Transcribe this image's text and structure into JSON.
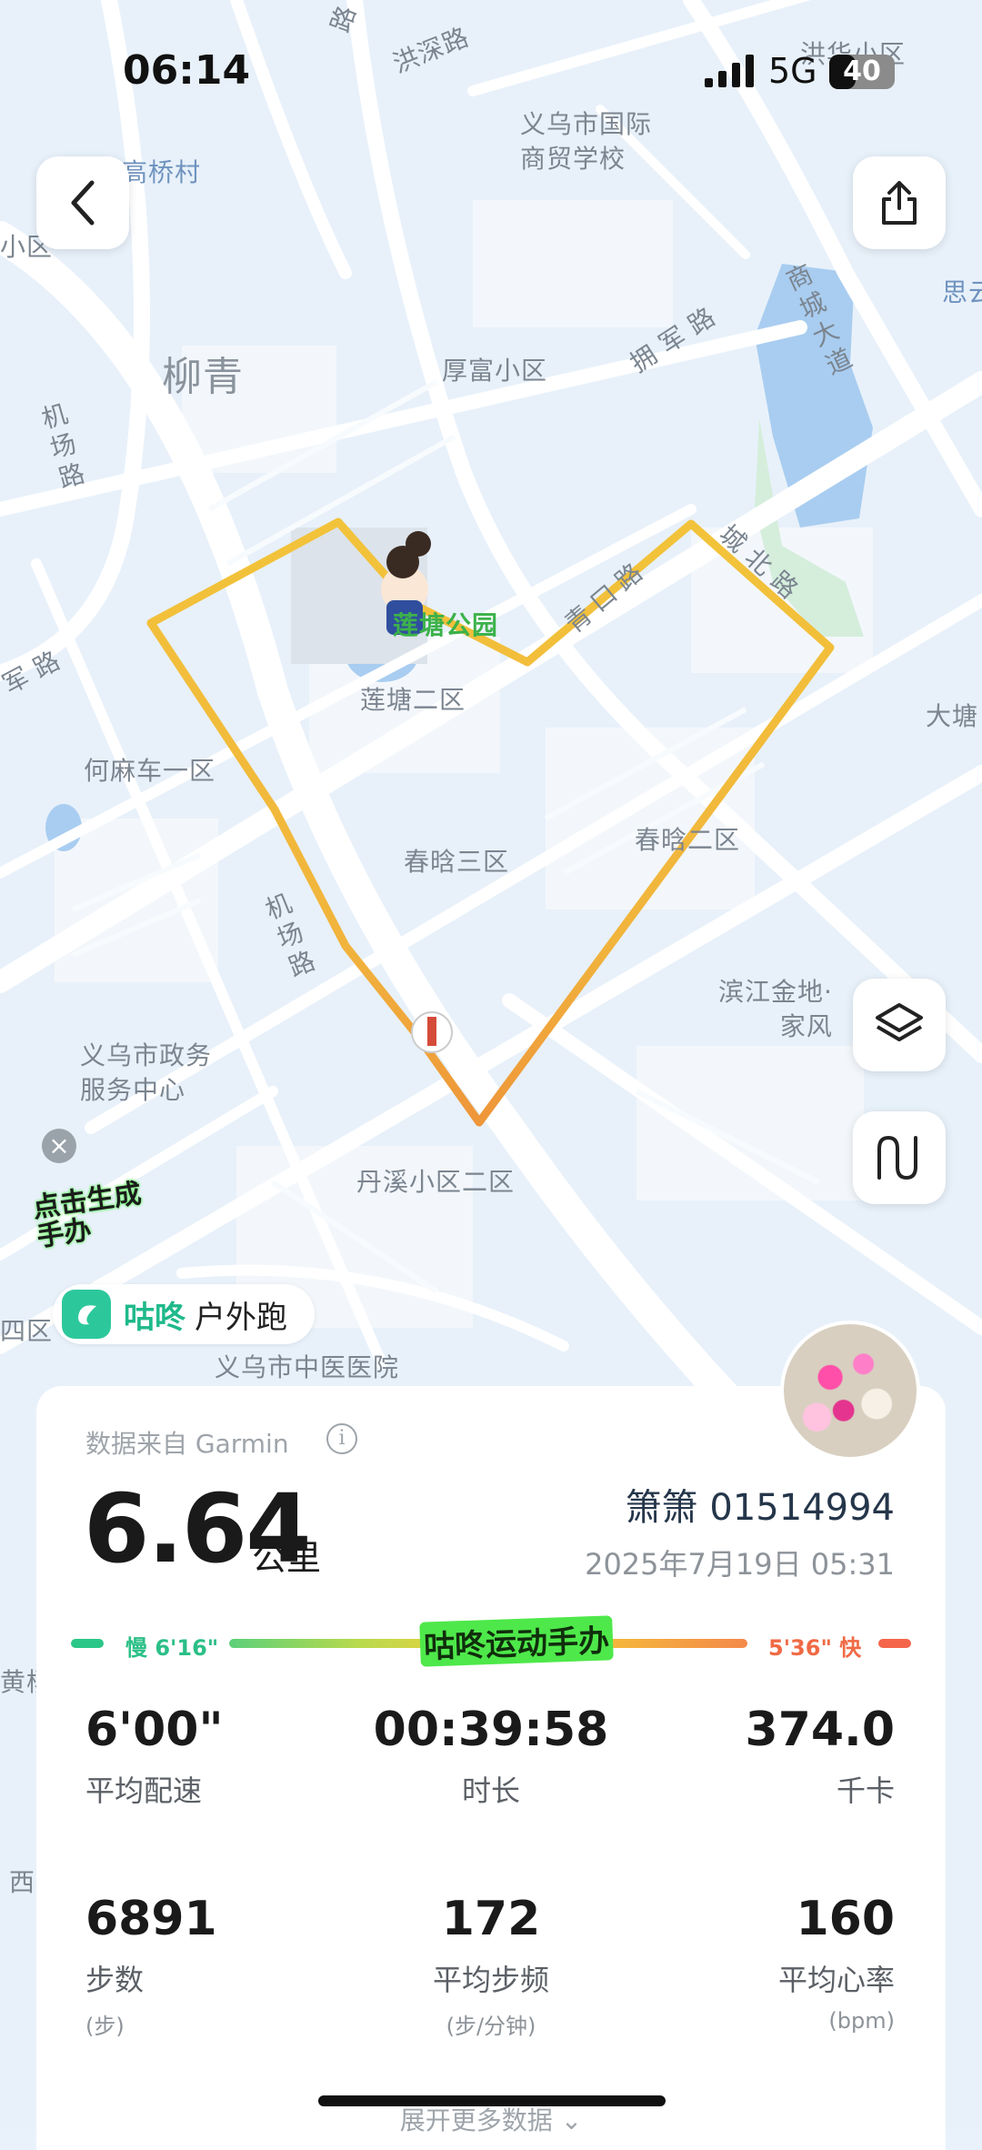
{
  "status": {
    "time": "06:14",
    "network": "5G",
    "battery": "40",
    "battery_fraction": 0.4
  },
  "map": {
    "labels": {
      "hongshen_road": "洪深路",
      "lu_top": "路",
      "hongxiang": "洪华小区",
      "gaoqiao": "高桥村",
      "xiaoqu_left": "小区",
      "yiwu_school": "义乌市国际\n商贸学校",
      "liuqing": "柳青",
      "houfu": "厚富小区",
      "yongjun_road": "拥军路",
      "shangcheng_road": "商城大道",
      "sisi": "思云",
      "jichang_road_top": "机场路",
      "jun_road": "军路",
      "liantang_park": "莲塘公园",
      "liantang_2": "莲塘二区",
      "chengbei_road": "城北路",
      "qinghan_road": "青口路",
      "dawang": "大塘",
      "hemache": "何麻车一区",
      "chunhan_3": "春晗三区",
      "chunhan_2": "春晗二区",
      "jichang_road_mid": "机场路",
      "yiwu_gov": "义乌市政务\n服务中心",
      "binjiang": "滨江金地·\n家风",
      "danxi": "丹溪小区二区",
      "si_qu": "四区",
      "hospital": "义乌市中医医院",
      "huang": "黄杨",
      "xi": "西"
    }
  },
  "sticker": {
    "text": "点击生成手办"
  },
  "app": {
    "name": "咕咚",
    "type": "户外跑"
  },
  "activity": {
    "source": "数据来自 Garmin",
    "distance": "6.64",
    "unit": "公里",
    "user": "箫箫 01514994",
    "datetime": "2025年7月19日 05:31",
    "pace_slow": "慢 6'16\"",
    "pace_fast": "5'36\" 快",
    "pace_sticker": "咕咚运动手办",
    "stats": [
      {
        "value": "6'00\"",
        "label": "平均配速",
        "sub": ""
      },
      {
        "value": "00:39:58",
        "label": "时长",
        "sub": ""
      },
      {
        "value": "374.0",
        "label": "千卡",
        "sub": ""
      },
      {
        "value": "6891",
        "label": "步数",
        "sub": "(步)"
      },
      {
        "value": "172",
        "label": "平均步频",
        "sub": "(步/分钟)"
      },
      {
        "value": "160",
        "label": "平均心率",
        "sub": "(bpm)"
      }
    ],
    "more": "展开更多数据"
  },
  "colors": {
    "route": "#f2c23a",
    "route_end": "#ef9a3a",
    "accent": "#1fb98b",
    "fast": "#f06a45",
    "slow": "#2bbf87"
  },
  "icons": {
    "back": "chevron-left-icon",
    "share": "share-icon",
    "layers": "layers-icon",
    "route": "route-icon",
    "info": "info-icon"
  }
}
